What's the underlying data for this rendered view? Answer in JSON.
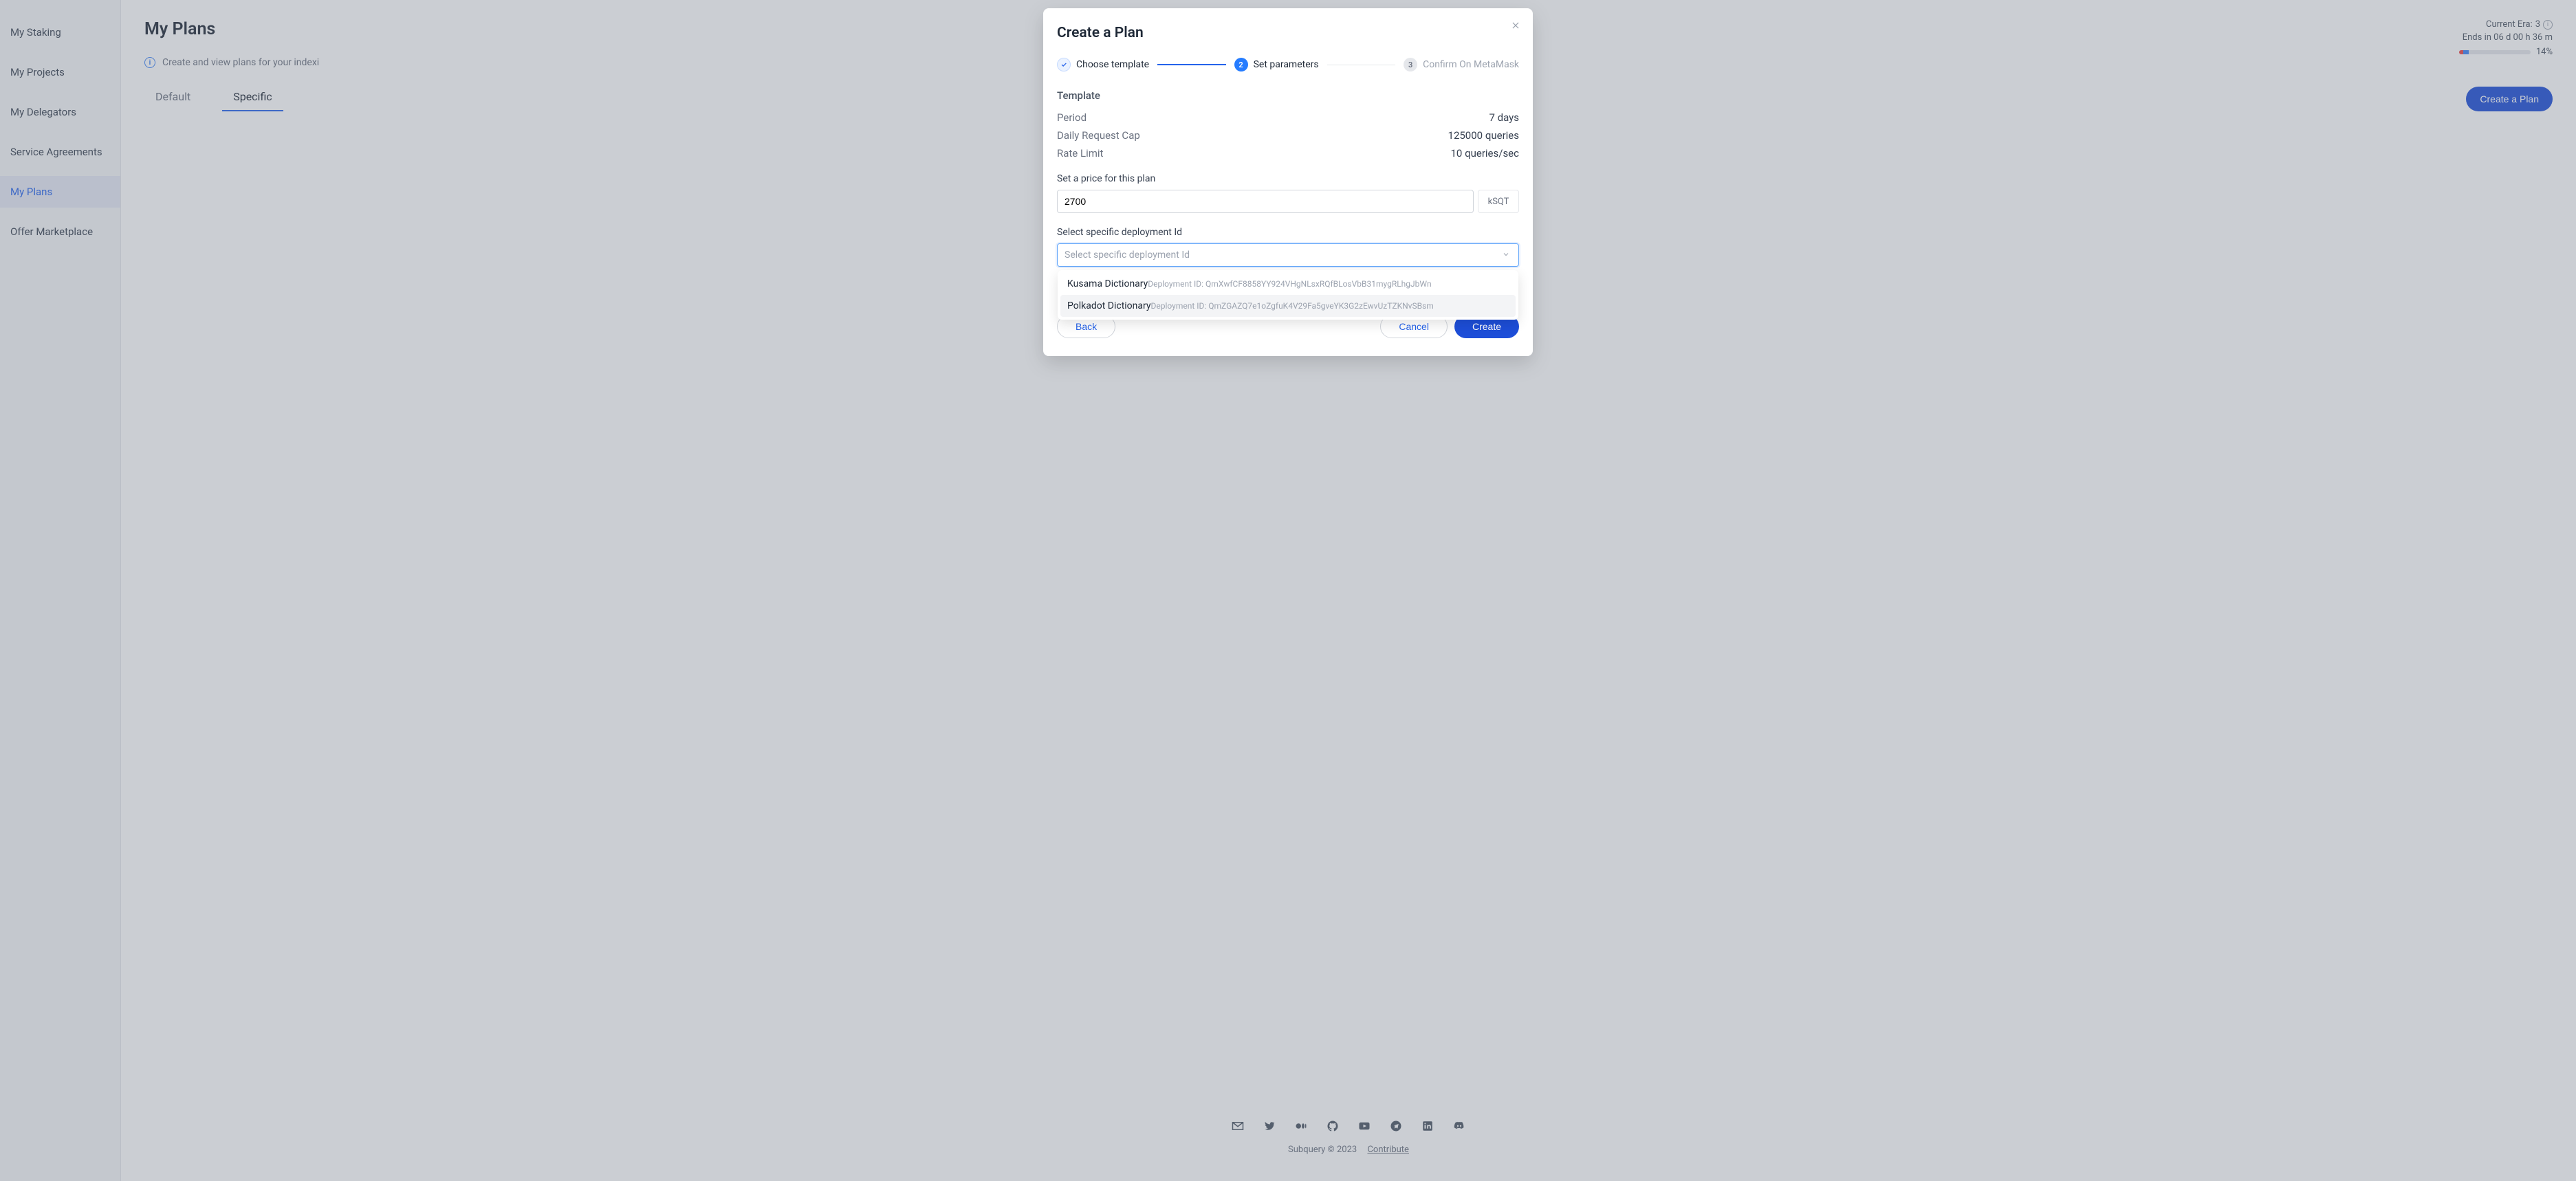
{
  "sidebar": {
    "items": [
      {
        "label": "My Staking"
      },
      {
        "label": "My Projects"
      },
      {
        "label": "My Delegators"
      },
      {
        "label": "Service Agreements"
      },
      {
        "label": "My Plans"
      },
      {
        "label": "Offer Marketplace"
      }
    ]
  },
  "page": {
    "title": "My Plans",
    "description": "Create and view plans for your indexi",
    "tabs": {
      "default": "Default",
      "specific": "Specific"
    },
    "create_btn": "Create a Plan"
  },
  "era": {
    "line1_prefix": "Current Era: ",
    "era_number": "3",
    "countdown": "Ends in 06 d 00 h 36 m",
    "percent": "14%"
  },
  "modal": {
    "title": "Create a Plan",
    "steps": {
      "s1": "Choose template",
      "s2": "Set parameters",
      "s3": "Confirm On MetaMask",
      "n2": "2",
      "n3": "3"
    },
    "template_heading": "Template",
    "kv": {
      "period_k": "Period",
      "period_v": "7 days",
      "dcap_k": "Daily Request Cap",
      "dcap_v": "125000 queries",
      "rate_k": "Rate Limit",
      "rate_v": "10 queries/sec"
    },
    "price_label": "Set a price for this plan",
    "price_value": "2700",
    "price_suffix": "kSQT",
    "dep_label": "Select specific deployment Id",
    "dep_placeholder": "Select specific deployment Id",
    "options": [
      {
        "name": "Kusama Dictionary",
        "did": "Deployment ID: QmXwfCF8858YY924VHgNLsxRQfBLosVbB31mygRLhgJbWn"
      },
      {
        "name": "Polkadot Dictionary",
        "did": "Deployment ID: QmZGAZQ7e1oZgfuK4V29Fa5gveYK3G2zEwvUzTZKNvSBsm"
      }
    ],
    "actions": {
      "back": "Back",
      "cancel": "Cancel",
      "create": "Create"
    }
  },
  "footer": {
    "copyright": "Subquery © 2023",
    "contribute": "Contribute"
  }
}
